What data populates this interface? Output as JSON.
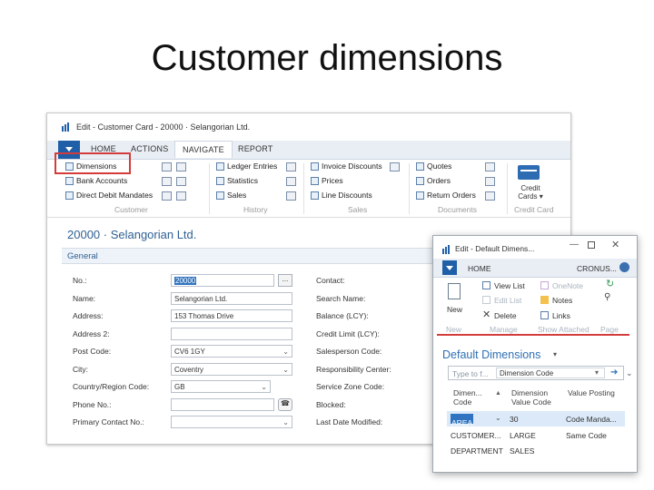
{
  "slide_title": "Customer dimensions",
  "main_window": {
    "title": "Edit - Customer Card - 20000 · Selangorian Ltd.",
    "tabs": [
      "HOME",
      "ACTIONS",
      "NAVIGATE",
      "REPORT"
    ],
    "active_tab": "NAVIGATE",
    "ribbon": {
      "customer_group": {
        "label": "Customer",
        "items": [
          "Dimensions",
          "Bank Accounts",
          "Direct Debit Mandates"
        ]
      },
      "history_group": {
        "label": "History",
        "items": [
          "Ledger Entries",
          "Statistics",
          "Sales"
        ]
      },
      "sales_group": {
        "label": "Sales",
        "items": [
          "Invoice Discounts",
          "Prices",
          "Line Discounts"
        ]
      },
      "documents_group": {
        "label": "Documents",
        "items": [
          "Quotes",
          "Orders",
          "Return Orders"
        ]
      },
      "creditcard_group": {
        "label": "Credit Card",
        "button": "Credit Cards ▾"
      }
    },
    "card_name": "20000 · Selangorian Ltd.",
    "section_title": "General",
    "left_fields": [
      {
        "label": "No.:",
        "value": "20000"
      },
      {
        "label": "Name:",
        "value": "Selangorian Ltd."
      },
      {
        "label": "Address:",
        "value": "153 Thomas Drive"
      },
      {
        "label": "Address 2:",
        "value": ""
      },
      {
        "label": "Post Code:",
        "value": "CV6 1GY"
      },
      {
        "label": "City:",
        "value": "Coventry"
      },
      {
        "label": "Country/Region Code:",
        "value": "GB"
      },
      {
        "label": "Phone No.:",
        "value": ""
      },
      {
        "label": "Primary Contact No.:",
        "value": ""
      }
    ],
    "right_labels": [
      "Contact:",
      "Search Name:",
      "Balance (LCY):",
      "Credit Limit (LCY):",
      "Salesperson Code:",
      "Responsibility Center:",
      "Service Zone Code:",
      "Blocked:",
      "Last Date Modified:"
    ]
  },
  "dialog": {
    "title": "Edit - Default Dimens...",
    "tab": "HOME",
    "company": "CRONUS...",
    "actions": {
      "new": "New",
      "view_list": "View List",
      "edit_list": "Edit List",
      "delete": "Delete",
      "onenote": "OneNote",
      "notes": "Notes",
      "links": "Links"
    },
    "groups": [
      "New",
      "Manage",
      "Show Attached",
      "Page"
    ],
    "heading": "Default Dimensions",
    "filter_placeholder": "Type to f...",
    "filter_field": "Dimension Code",
    "columns": [
      "Dimen... Code",
      "Dimension Value Code",
      "Value Posting"
    ],
    "rows": [
      {
        "dimension": "AREA",
        "value": "30",
        "posting": "Code Manda..."
      },
      {
        "dimension": "CUSTOMER...",
        "value": "LARGE",
        "posting": "Same Code"
      },
      {
        "dimension": "DEPARTMENT",
        "value": "SALES",
        "posting": ""
      }
    ]
  }
}
